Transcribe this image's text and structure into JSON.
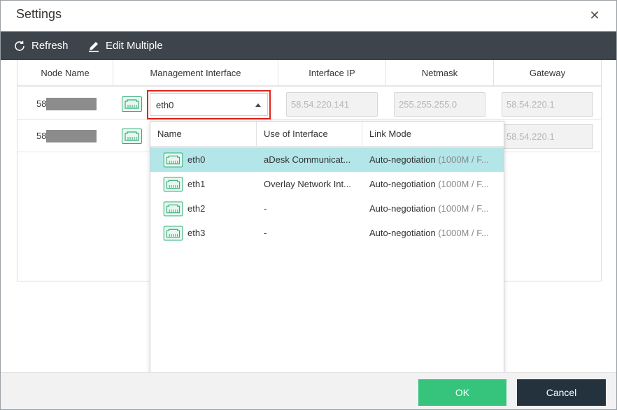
{
  "dialog": {
    "title": "Settings",
    "close_icon": "close-icon"
  },
  "toolbar": {
    "refresh_label": "Refresh",
    "edit_multiple_label": "Edit Multiple"
  },
  "table": {
    "headers": [
      "Node Name",
      "Management Interface",
      "Interface IP",
      "Netmask",
      "Gateway"
    ],
    "rows": [
      {
        "node_name": "58",
        "interface": "eth0",
        "interface_ip": "58.54.220.141",
        "netmask": "255.255.255.0",
        "gateway": "58.54.220.1"
      },
      {
        "node_name": "58",
        "gateway": "58.54.220.1"
      }
    ]
  },
  "dropdown": {
    "headers": [
      "Name",
      "Use of Interface",
      "Link Mode"
    ],
    "items": [
      {
        "name": "eth0",
        "use": "aDesk Communicat...",
        "mode": "Auto-negotiation",
        "mode_detail": "(1000M / F...",
        "selected": true
      },
      {
        "name": "eth1",
        "use": "Overlay Network Int...",
        "mode": "Auto-negotiation",
        "mode_detail": "(1000M / F...",
        "selected": false
      },
      {
        "name": "eth2",
        "use": "-",
        "mode": "Auto-negotiation",
        "mode_detail": "(1000M / F...",
        "selected": false
      },
      {
        "name": "eth3",
        "use": "-",
        "mode": "Auto-negotiation",
        "mode_detail": "(1000M / F...",
        "selected": false
      }
    ]
  },
  "footer": {
    "ok_label": "OK",
    "cancel_label": "Cancel"
  },
  "colors": {
    "toolbar_bg": "#3d444b",
    "selected_row": "#b3e6e9",
    "ok_button": "#36c47c",
    "cancel_button": "#24323e",
    "highlight_border": "#e2231a",
    "nic_icon": "#2fae78"
  }
}
